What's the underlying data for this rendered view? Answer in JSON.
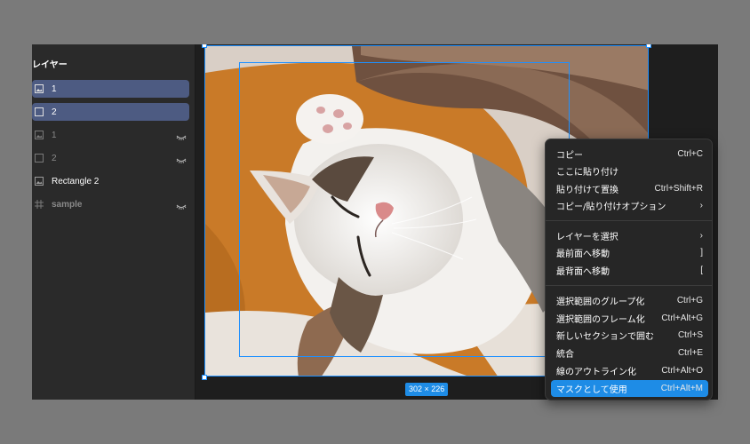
{
  "layers_panel": {
    "title": "レイヤー",
    "items": [
      {
        "label": "1",
        "icon": "image-icon",
        "selected": true
      },
      {
        "label": "2",
        "icon": "rectangle-icon",
        "selected": true
      },
      {
        "label": "1",
        "icon": "image-icon",
        "hidden": true
      },
      {
        "label": "2",
        "icon": "rectangle-icon",
        "hidden": true
      },
      {
        "label": "Rectangle 2",
        "icon": "image-icon"
      },
      {
        "label": "sample",
        "icon": "frame-icon",
        "hidden": true
      }
    ]
  },
  "canvas": {
    "selection_size": "302 × 226"
  },
  "context_menu": {
    "items": [
      {
        "label": "コピー",
        "shortcut": "Ctrl+C"
      },
      {
        "label": "ここに貼り付け",
        "shortcut": ""
      },
      {
        "label": "貼り付けて置換",
        "shortcut": "Ctrl+Shift+R"
      },
      {
        "label": "コピー/貼り付けオプション",
        "shortcut": "›"
      },
      {
        "label": "レイヤーを選択",
        "shortcut": "›"
      },
      {
        "label": "最前面へ移動",
        "shortcut": "]"
      },
      {
        "label": "最背面へ移動",
        "shortcut": "["
      },
      {
        "label": "選択範囲のグループ化",
        "shortcut": "Ctrl+G"
      },
      {
        "label": "選択範囲のフレーム化",
        "shortcut": "Ctrl+Alt+G"
      },
      {
        "label": "新しいセクションで囲む",
        "shortcut": "Ctrl+S"
      },
      {
        "label": "統合",
        "shortcut": "Ctrl+E"
      },
      {
        "label": "線のアウトライン化",
        "shortcut": "Ctrl+Alt+O"
      },
      {
        "label": "マスクとして使用",
        "shortcut": "Ctrl+Alt+M",
        "highlighted": true
      }
    ]
  },
  "colors": {
    "selection_accent": "#1e8ce6",
    "selected_layer_bg": "#4d5b82"
  }
}
